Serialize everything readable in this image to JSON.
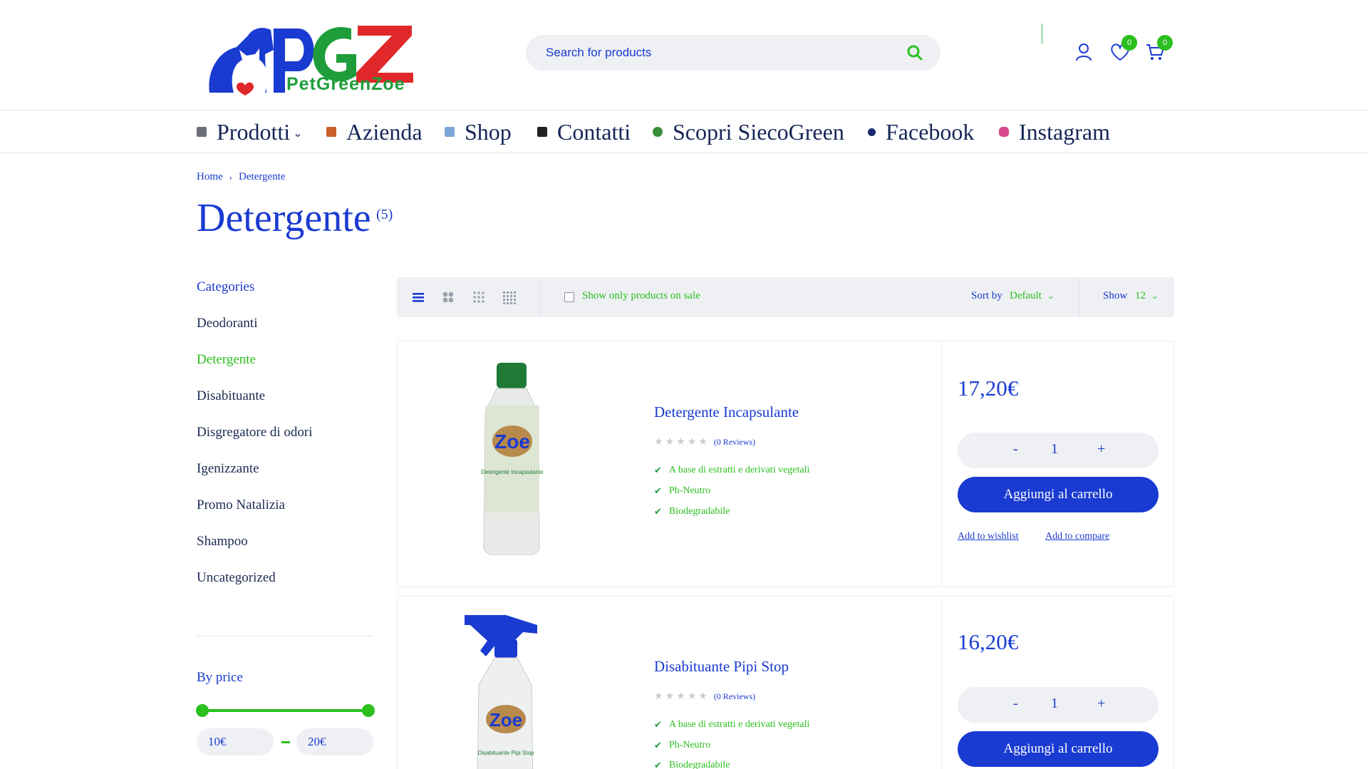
{
  "header": {
    "logo_text": "PetGreenZoe",
    "search_placeholder": "Search for products",
    "wishlist_count": "0",
    "cart_count": "0"
  },
  "nav": [
    {
      "label": "Prodotti"
    },
    {
      "label": "Azienda"
    },
    {
      "label": "Shop"
    },
    {
      "label": "Contatti"
    },
    {
      "label": "Scopri SiecoGreen"
    },
    {
      "label": "Facebook"
    },
    {
      "label": "Instagram"
    }
  ],
  "breadcrumb": {
    "home": "Home",
    "current": "Detergente"
  },
  "page": {
    "title": "Detergente",
    "count": "(5)"
  },
  "sidebar": {
    "categories_title": "Categories",
    "categories": [
      "Deodoranti",
      "Detergente",
      "Disabituante",
      "Disgregatore di odori",
      "Igenizzante",
      "Promo Natalizia",
      "Shampoo",
      "Uncategorized"
    ],
    "active_category": "Detergente",
    "price_title": "By price",
    "price_min": "10€",
    "price_max": "20€"
  },
  "toolbar": {
    "sale_label": "Show only products on sale",
    "sort_label": "Sort by",
    "sort_value": "Default",
    "show_label": "Show",
    "show_value": "12"
  },
  "products": [
    {
      "name": "Detergente Incapsulante",
      "reviews": "(0 Reviews)",
      "features": [
        "A base di estratti e derivati vegetali",
        "Ph-Neutro",
        "Biodegradabile"
      ],
      "price": "17,20€",
      "qty": "1",
      "add_to_cart": "Aggiungi al carrello",
      "wishlist": "Add to wishlist",
      "compare": "Add to compare",
      "bottle_label": "Detergente Incapsulante",
      "bottle_brand": "Zoe"
    },
    {
      "name": "Disabituante Pipi Stop",
      "reviews": "(0 Reviews)",
      "features": [
        "A base di estratti e derivati vegetali",
        "Ph-Neutro",
        "Biodegradabile"
      ],
      "price": "16,20€",
      "qty": "1",
      "add_to_cart": "Aggiungi al carrello",
      "bottle_label": "Disabituante Pipi Stop",
      "bottle_brand": "Zoe"
    }
  ],
  "qty_controls": {
    "minus": "-",
    "plus": "+"
  },
  "colors": {
    "brand_blue": "#1a3bd1",
    "brand_green": "#2bbf1f",
    "logo_red": "#e0282b"
  }
}
